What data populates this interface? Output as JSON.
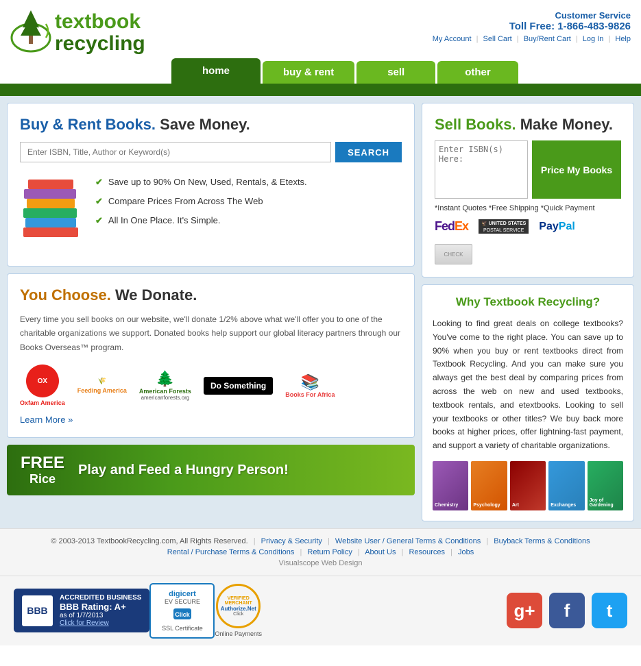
{
  "header": {
    "logo_line1": "textbook",
    "logo_line2": "recycling",
    "cs_label": "Customer Service",
    "toll_free_label": "Toll Free: 1-866-483-9826",
    "links": [
      "My Account",
      "Sell Cart",
      "Buy/Rent Cart",
      "Log In",
      "Help"
    ]
  },
  "nav": {
    "tabs": [
      {
        "label": "home",
        "active": true
      },
      {
        "label": "buy & rent",
        "active": false
      },
      {
        "label": "sell",
        "active": false
      },
      {
        "label": "other",
        "active": false
      }
    ]
  },
  "buy_rent": {
    "title_colored": "Buy & Rent Books.",
    "title_black": " Save Money.",
    "search_placeholder": "Enter ISBN, Title, Author or Keyword(s)",
    "search_button": "SEARCH",
    "features": [
      "Save up to 90% On New, Used, Rentals, & Etexts.",
      "Compare Prices From Across The Web",
      "All In One Place. It's Simple."
    ]
  },
  "sell": {
    "title_colored": "Sell Books.",
    "title_black": " Make Money.",
    "isbn_placeholder": "Enter ISBN(s) Here:",
    "price_button": "Price My Books",
    "instant_label": "*Instant Quotes  *Free Shipping  *Quick Payment",
    "payment_logos": [
      "FedEx",
      "USPS",
      "PayPal"
    ]
  },
  "donate": {
    "title_colored": "You Choose.",
    "title_black": " We Donate.",
    "text": "Every time you sell books on our website, we'll donate 1/2% above what we'll offer you to one of the charitable organizations we support. Donated books help support our global literacy partners through our Books Overseas™ program.",
    "orgs": [
      "Oxfam America",
      "Feeding America",
      "American Forests",
      "Do Something",
      "Books For Africa"
    ],
    "learn_more": "Learn More »"
  },
  "why": {
    "title": "Why Textbook Recycling?",
    "text": "Looking to find great deals on college textbooks? You've come to the right place. You can save up to 90% when you buy or rent textbooks direct from Textbook Recycling. And you can make sure you always get the best deal by comparing prices from across the web on new and used textbooks, textbook rentals, and etextbooks. Looking to sell your textbooks or other titles? We buy back more books at higher prices, offer lightning-fast payment, and support a variety of charitable organizations.",
    "book_subjects": [
      "Chemistry",
      "Psychology",
      "Art",
      "Exchanges",
      "Joy of Gardening"
    ]
  },
  "freerice": {
    "logo_free": "FREE",
    "logo_rice": "Rice",
    "tagline": "Play and Feed a Hungry Person!"
  },
  "footer": {
    "copyright": "© 2003-2013 TextbookRecycling.com, All Rights Reserved.",
    "links_row1": [
      "Privacy & Security",
      "Website User / General Terms & Conditions",
      "Buyback Terms & Conditions"
    ],
    "links_row2": [
      "Rental / Purchase Terms & Conditions",
      "Return Policy",
      "About Us",
      "Resources",
      "Jobs"
    ],
    "powered_by": "Visualscope Web Design"
  },
  "trust": {
    "bbb_title": "ACCREDITED BUSINESS",
    "bbb_rating": "BBB Rating: A+",
    "bbb_date": "as of 1/7/2013",
    "bbb_link": "Click for Review",
    "digicert_label": "digicert",
    "digicert_sub": "EV SECURE",
    "digicert_bottom": "SSL Certificate",
    "auth_label": "VERIFIED MERCHANT",
    "auth_sub": "Authorize.Net",
    "auth_click": "Click",
    "auth_payments": "Online Payments"
  },
  "social": {
    "gplus_label": "g+",
    "fb_label": "f",
    "tw_label": "t"
  }
}
